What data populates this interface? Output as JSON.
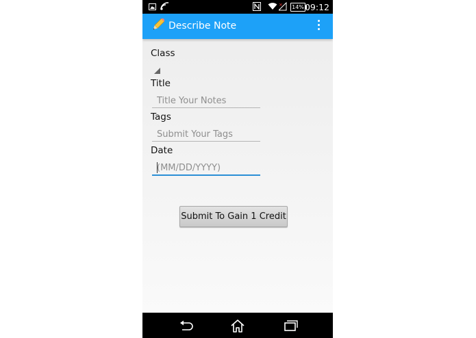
{
  "status_bar": {
    "time": "09:12",
    "battery": "14%",
    "icons": [
      "image-icon",
      "wifi-cast-icon",
      "nfc-icon",
      "wifi-icon",
      "no-signal-icon",
      "battery-icon"
    ]
  },
  "action_bar": {
    "app_icon": "pencil-icon",
    "title": "Describe Note",
    "menu_icon": "overflow-menu-icon",
    "color": "#1da1f8"
  },
  "form": {
    "class_label": "Class",
    "class_value": "",
    "title_label": "Title",
    "title_placeholder": "Title Your Notes",
    "tags_label": "Tags",
    "tags_placeholder": "Submit Your Tags",
    "date_label": "Date",
    "date_placeholder": "(MM/DD/YYYY)",
    "focus_color": "#2a8fd6"
  },
  "submit_button": {
    "label": "Submit To Gain 1 Credit"
  },
  "nav_bar": {
    "icons": [
      "back-icon",
      "home-icon",
      "recent-apps-icon"
    ]
  }
}
